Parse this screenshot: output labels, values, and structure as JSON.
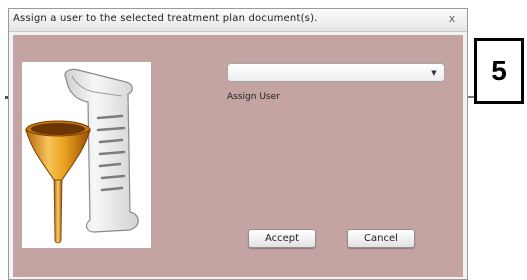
{
  "dialog": {
    "title": "Assign a user to the selected treatment plan document(s).",
    "close_glyph": "x",
    "close_icon": "close-icon"
  },
  "illustration": {
    "icon": "document-funnel-illustration",
    "colors": {
      "funnel": "#e8a21c",
      "paper": "#e9e9e9"
    }
  },
  "form": {
    "user_dropdown": {
      "selected_value": "",
      "arrow_glyph": "▼",
      "arrow_icon": "dropdown-arrow-icon"
    },
    "assign_user_label": "Assign User"
  },
  "buttons": {
    "accept_label": "Accept",
    "cancel_label": "Cancel"
  },
  "step_badge": {
    "number": "5"
  },
  "colors": {
    "content_background": "#c4a3a3",
    "titlebar": "#eeeeee"
  }
}
